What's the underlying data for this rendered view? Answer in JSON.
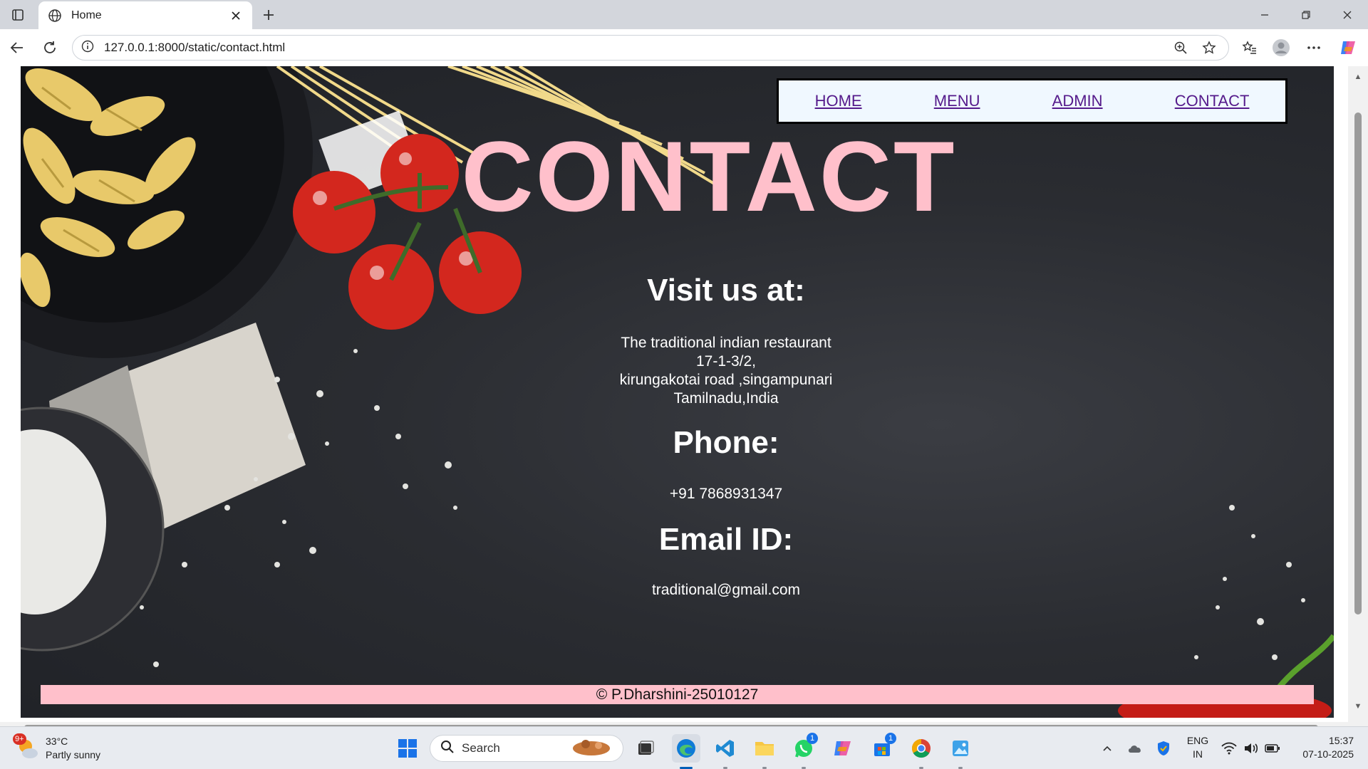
{
  "browser": {
    "tab_title": "Home",
    "url": "127.0.0.1:8000/static/contact.html"
  },
  "nav": {
    "items": [
      "HOME",
      "MENU",
      "ADMIN",
      "CONTACT"
    ]
  },
  "page": {
    "title": "CONTACT",
    "visit_heading": "Visit us at:",
    "address_lines": [
      "The traditional indian restaurant",
      "17-1-3/2,",
      "kirungakotai road ,singampunari",
      "Tamilnadu,India"
    ],
    "phone_heading": "Phone:",
    "phone": "+91 7868931347",
    "email_heading": "Email ID:",
    "email": "traditional@gmail.com",
    "footer": "© P.Dharshini-25010127"
  },
  "taskbar": {
    "weather_temp": "33°C",
    "weather_desc": "Partly sunny",
    "weather_badge": "9+",
    "search_label": "Search",
    "whatsapp_badge": "1",
    "store_badge": "1",
    "lang_line1": "ENG",
    "lang_line2": "IN",
    "time": "15:37",
    "date": "07-10-2025"
  },
  "colors": {
    "title_pink": "#ffc0cb",
    "nav_link": "#551a8b",
    "nav_bg": "#f0f8ff",
    "hero_dark": "#2a2c31"
  }
}
